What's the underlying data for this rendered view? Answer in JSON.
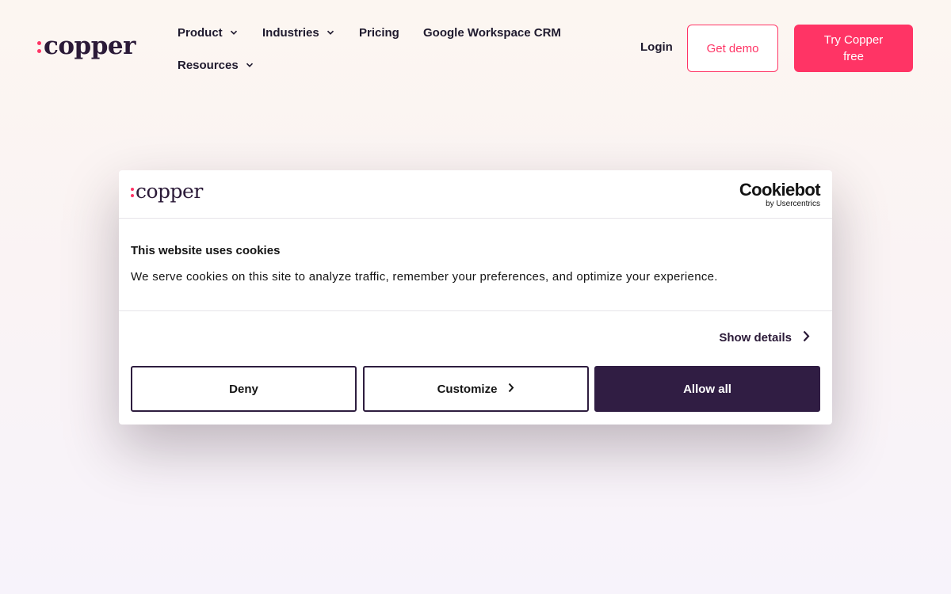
{
  "brand": {
    "name": "copper",
    "accent": "#ff3465",
    "dark": "#2b1a38"
  },
  "nav": {
    "items": [
      {
        "label": "Product",
        "dropdown": true
      },
      {
        "label": "Industries",
        "dropdown": true
      },
      {
        "label": "Pricing",
        "dropdown": false
      },
      {
        "label": "Google Workspace CRM",
        "dropdown": false
      },
      {
        "label": "Resources",
        "dropdown": true
      }
    ],
    "login": "Login",
    "demo_button": "Get demo",
    "try_button": "Try Copper free"
  },
  "cookie_dialog": {
    "logo": "copper",
    "provider": "Cookiebot",
    "provider_by": "by Usercentrics",
    "title": "This website uses cookies",
    "text": "We serve cookies on this site to analyze traffic, remember your preferences, and optimize your experience.",
    "show_details": "Show details",
    "deny": "Deny",
    "customize": "Customize",
    "allow_all": "Allow all",
    "button_color": "#301d43"
  }
}
